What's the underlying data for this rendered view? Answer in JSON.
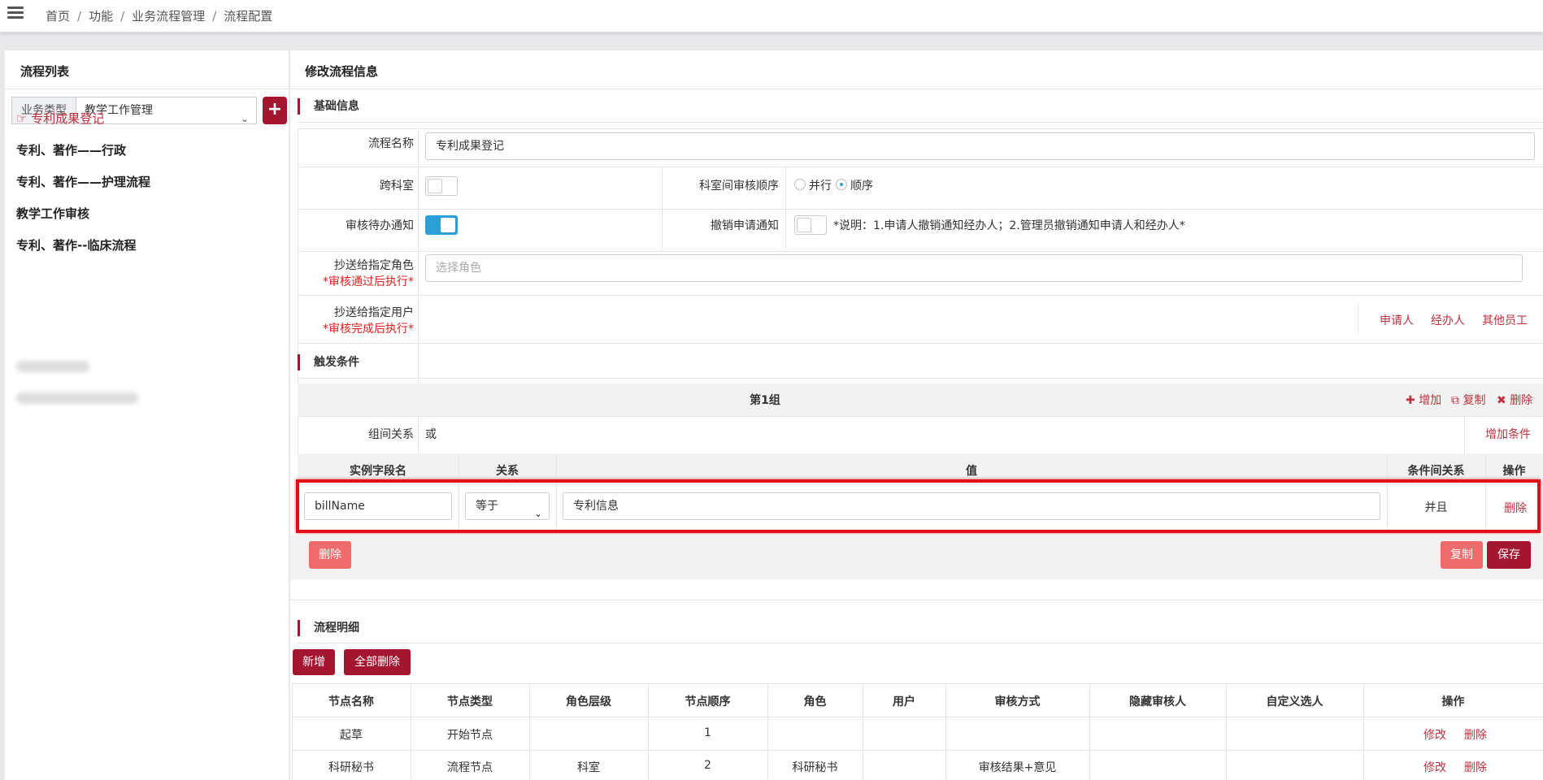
{
  "breadcrumb": [
    "首页",
    "功能",
    "业务流程管理",
    "流程配置"
  ],
  "left": {
    "title": "流程列表",
    "type_label": "业务类型",
    "type_value": "教学工作管理",
    "add_label": "+",
    "flows": [
      {
        "label": "专利成果登记",
        "active": true
      },
      {
        "label": "专利、著作——行政"
      },
      {
        "label": "专利、著作——护理流程"
      },
      {
        "label": "教学工作审核"
      },
      {
        "label": "专利、著作--临床流程"
      }
    ]
  },
  "right": {
    "title": "修改流程信息",
    "basic": {
      "section": "基础信息",
      "name_label": "流程名称",
      "name_value": "专利成果登记",
      "cross_label": "跨科室",
      "order_label": "科室间审核顺序",
      "order_options": [
        "并行",
        "顺序"
      ],
      "order_selected": "顺序",
      "notify_label": "审核待办通知",
      "notify_on": true,
      "cancel_label": "撤销申请通知",
      "cancel_note": "*说明：1.申请人撤销通知经办人；2.管理员撤销通知申请人和经办人*",
      "cc_role_label": "抄送给指定角色",
      "cc_role_note": "*审核通过后执行*",
      "cc_role_placeholder": "选择角色",
      "cc_user_label": "抄送给指定用户",
      "cc_user_note": "*审核完成后执行*",
      "cc_user_links": [
        "申请人",
        "经办人",
        "其他员工"
      ]
    },
    "trigger": {
      "section": "触发条件",
      "group_title": "第1组",
      "group_actions": [
        "增加",
        "复制",
        "删除"
      ],
      "relation_label": "组间关系",
      "relation_value": "或",
      "add_condition": "增加条件",
      "columns": [
        "实例字段名",
        "关系",
        "值",
        "条件间关系",
        "操作"
      ],
      "row": {
        "field": "billName",
        "op": "等于",
        "value": "专利信息",
        "logic": "并且",
        "action": "删除"
      },
      "delete_btn": "删除",
      "copy_btn": "复制",
      "save_btn": "保存"
    },
    "details": {
      "section": "流程明细",
      "add_btn": "新增",
      "delete_all_btn": "全部删除",
      "columns": [
        "节点名称",
        "节点类型",
        "角色层级",
        "节点顺序",
        "角色",
        "用户",
        "审核方式",
        "隐藏审核人",
        "自定义选人",
        "操作"
      ],
      "rows": [
        {
          "name": "起草",
          "type": "开始节点",
          "level": "",
          "order": "1",
          "role": "",
          "user": "",
          "method": "",
          "hidden": "",
          "custom": "",
          "edit": "修改",
          "del": "删除"
        },
        {
          "name": "科研秘书",
          "type": "流程节点",
          "level": "科室",
          "order": "2",
          "role": "科研秘书",
          "user": "",
          "method": "审核结果+意见",
          "hidden": "",
          "custom": "",
          "edit": "修改",
          "del": "删除"
        }
      ]
    }
  }
}
